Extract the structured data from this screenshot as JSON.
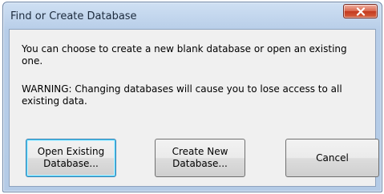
{
  "dialog": {
    "title": "Find or Create Database",
    "message_line1": "You can choose to create a new blank database or open an existing one.",
    "message_line2": "WARNING: Changing databases will cause you to lose access to all existing data."
  },
  "buttons": {
    "open_existing": "Open Existing\nDatabase...",
    "create_new": "Create New\nDatabase...",
    "cancel": "Cancel"
  },
  "icons": {
    "close": "close-x-icon"
  },
  "colors": {
    "title_bar": "#b7cde8",
    "close_button": "#c4391f",
    "dialog_body": "#f0f0f0",
    "default_button_border": "#3c7fb1"
  }
}
